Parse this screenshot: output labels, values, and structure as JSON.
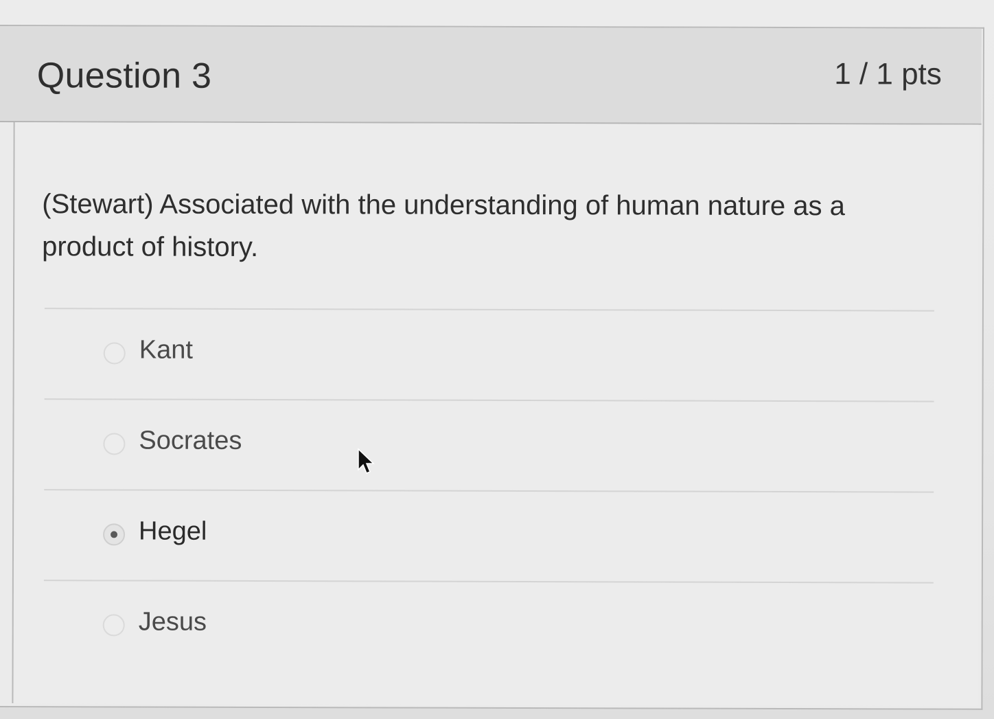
{
  "question": {
    "title": "Question 3",
    "points": "1 / 1 pts",
    "text": "(Stewart) Associated with the understanding of human nature as a product of history."
  },
  "answers": [
    {
      "label": "Kant",
      "selected": false
    },
    {
      "label": "Socrates",
      "selected": false
    },
    {
      "label": "Hegel",
      "selected": true
    },
    {
      "label": "Jesus",
      "selected": false
    }
  ],
  "icons": {
    "cursor": "mouse-pointer-icon"
  }
}
